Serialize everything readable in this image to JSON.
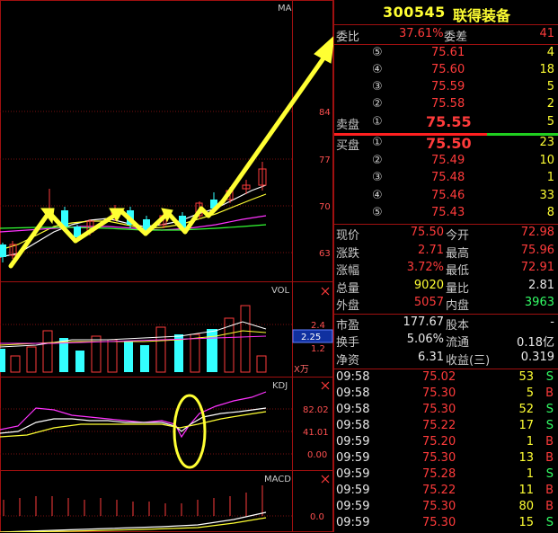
{
  "stock": {
    "code": "300545",
    "name": "联得装备"
  },
  "chart_labels": {
    "main": "MA",
    "vol": "VOL",
    "vol_unit": "X万",
    "kdj": "KDJ",
    "macd": "MACD",
    "close_icon": "close-icon"
  },
  "price_axis": [
    "84",
    "77",
    "70",
    "63"
  ],
  "vol_axis": {
    "top": "2.4",
    "highlight": "2.25",
    "bottom": "1.2"
  },
  "kdj_axis": [
    "82.02",
    "41.01",
    "0.00"
  ],
  "macd_axis": [
    "0.0"
  ],
  "order_ratio": {
    "label_a": "委比",
    "value_a": "37.61%",
    "label_b": "委差",
    "value_b": "41"
  },
  "sell_label": "卖盘",
  "buy_label": "买盘",
  "sell_orders": [
    {
      "idx": "⑤",
      "price": "75.61",
      "vol": "4"
    },
    {
      "idx": "④",
      "price": "75.60",
      "vol": "18"
    },
    {
      "idx": "③",
      "price": "75.59",
      "vol": "5"
    },
    {
      "idx": "②",
      "price": "75.58",
      "vol": "2"
    },
    {
      "idx": "①",
      "price": "75.55",
      "vol": "5"
    }
  ],
  "buy_orders": [
    {
      "idx": "①",
      "price": "75.50",
      "vol": "23"
    },
    {
      "idx": "②",
      "price": "75.49",
      "vol": "10"
    },
    {
      "idx": "③",
      "price": "75.48",
      "vol": "1"
    },
    {
      "idx": "④",
      "price": "75.46",
      "vol": "33"
    },
    {
      "idx": "⑤",
      "price": "75.43",
      "vol": "8"
    }
  ],
  "stats": [
    {
      "l1": "现价",
      "v1": "75.50",
      "c1": "red",
      "l2": "今开",
      "v2": "72.98",
      "c2": "red"
    },
    {
      "l1": "涨跌",
      "v1": "2.71",
      "c1": "red",
      "l2": "最高",
      "v2": "75.96",
      "c2": "red"
    },
    {
      "l1": "涨幅",
      "v1": "3.72%",
      "c1": "red",
      "l2": "最低",
      "v2": "72.91",
      "c2": "red"
    },
    {
      "l1": "总量",
      "v1": "9020",
      "c1": "yellow",
      "l2": "量比",
      "v2": "2.81",
      "c2": "white"
    },
    {
      "l1": "外盘",
      "v1": "5057",
      "c1": "red",
      "l2": "内盘",
      "v2": "3963",
      "c2": "green"
    }
  ],
  "fundamentals": [
    {
      "l1": "市盈",
      "v1": "177.67",
      "l2": "股本",
      "v2": "-"
    },
    {
      "l1": "换手",
      "v1": "5.06%",
      "l2": "流通",
      "v2": "0.18亿"
    },
    {
      "l1": "净资",
      "v1": "6.31",
      "l2": "收益(三)",
      "v2": "0.319"
    }
  ],
  "ticks": [
    {
      "time": "09:58",
      "price": "75.02",
      "vol": "53",
      "side": "S"
    },
    {
      "time": "09:58",
      "price": "75.30",
      "vol": "5",
      "side": "B"
    },
    {
      "time": "09:58",
      "price": "75.30",
      "vol": "52",
      "side": "S"
    },
    {
      "time": "09:58",
      "price": "75.22",
      "vol": "17",
      "side": "S"
    },
    {
      "time": "09:59",
      "price": "75.20",
      "vol": "1",
      "side": "B"
    },
    {
      "time": "09:59",
      "price": "75.30",
      "vol": "13",
      "side": "B"
    },
    {
      "time": "09:59",
      "price": "75.28",
      "vol": "1",
      "side": "S"
    },
    {
      "time": "09:59",
      "price": "75.22",
      "vol": "11",
      "side": "B"
    },
    {
      "time": "09:59",
      "price": "75.30",
      "vol": "80",
      "side": "B"
    },
    {
      "time": "09:59",
      "price": "75.30",
      "vol": "15",
      "side": "S"
    }
  ],
  "colors": {
    "up": "#ff3b3b",
    "down": "#33ffff",
    "accent": "#ffff33",
    "green": "#33ff66",
    "grid": "#a01010"
  }
}
